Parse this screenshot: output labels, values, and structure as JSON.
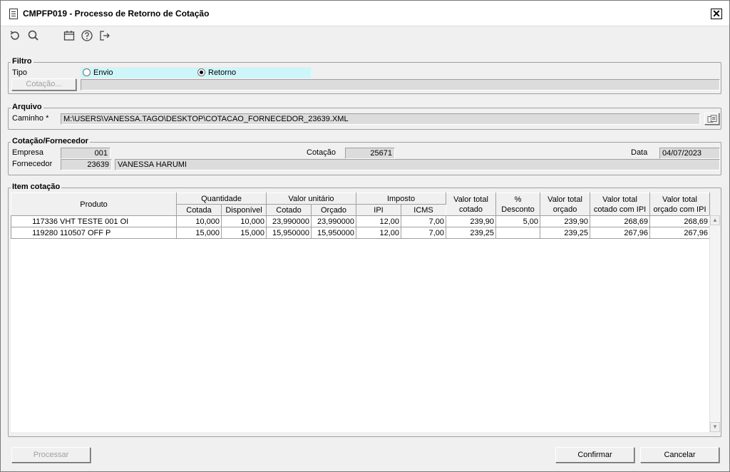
{
  "window": {
    "title": "CMPFP019 - Processo de Retorno de Cotação",
    "close": "✕"
  },
  "toolbar": {
    "icons": [
      "refresh-icon",
      "search-icon",
      "calendar-icon",
      "help-icon",
      "exit-icon"
    ]
  },
  "filtro": {
    "title": "Filtro",
    "tipo_label": "Tipo",
    "opt_envio": "Envio",
    "opt_retorno": "Retorno",
    "selected": "Retorno",
    "cotacao_button": "Cotação...",
    "cotacao_value": ""
  },
  "arquivo": {
    "title": "Arquivo",
    "caminho_label": "Caminho *",
    "caminho_value": "M:\\USERS\\VANESSA.TAGO\\DESKTOP\\COTACAO_FORNECEDOR_23639.XML"
  },
  "cotacao_fornecedor": {
    "title": "Cotação/Fornecedor",
    "empresa_label": "Empresa",
    "empresa_value": "001",
    "cotacao_label": "Cotação",
    "cotacao_value": "25671",
    "data_label": "Data",
    "data_value": "04/07/2023",
    "fornecedor_label": "Fornecedor",
    "fornecedor_code": "23639",
    "fornecedor_name": "VANESSA HARUMI"
  },
  "item_cotacao": {
    "title": "Item cotação",
    "headers": {
      "produto": "Produto",
      "quantidade": "Quantidade",
      "cotada": "Cotada",
      "disponivel": "Disponível",
      "valor_unitario": "Valor unitário",
      "cotado": "Cotado",
      "orcado": "Orçado",
      "imposto": "Imposto",
      "ipi": "IPI",
      "icms": "ICMS",
      "valor_total_cotado_1": "Valor total",
      "valor_total_cotado_2": "cotado",
      "desconto_1": "%",
      "desconto_2": "Desconto",
      "valor_total_orcado_1": "Valor total",
      "valor_total_orcado_2": "orçado",
      "vt_cotado_ipi_1": "Valor total",
      "vt_cotado_ipi_2": "cotado com IPI",
      "vt_orcado_ipi_1": "Valor total",
      "vt_orcado_ipi_2": "orçado com IPI"
    },
    "rows": [
      {
        "codigo": "117336",
        "produto": "VHT TESTE 001 OI",
        "cotada": "10,000",
        "disponivel": "10,000",
        "cotado": "23,990000",
        "orcado": "23,990000",
        "ipi": "12,00",
        "icms": "7,00",
        "vt_cotado": "239,90",
        "desconto": "5,00",
        "vt_orcado": "239,90",
        "vt_cotado_ipi": "268,69",
        "vt_orcado_ipi": "268,69"
      },
      {
        "codigo": "119280",
        "produto": "110507 OFF P",
        "cotada": "15,000",
        "disponivel": "15,000",
        "cotado": "15,950000",
        "orcado": "15,950000",
        "ipi": "12,00",
        "icms": "7,00",
        "vt_cotado": "239,25",
        "desconto": "",
        "vt_orcado": "239,25",
        "vt_cotado_ipi": "267,96",
        "vt_orcado_ipi": "267,96"
      }
    ]
  },
  "footer": {
    "processar": "Processar",
    "confirmar": "Confirmar",
    "cancelar": "Cancelar"
  }
}
